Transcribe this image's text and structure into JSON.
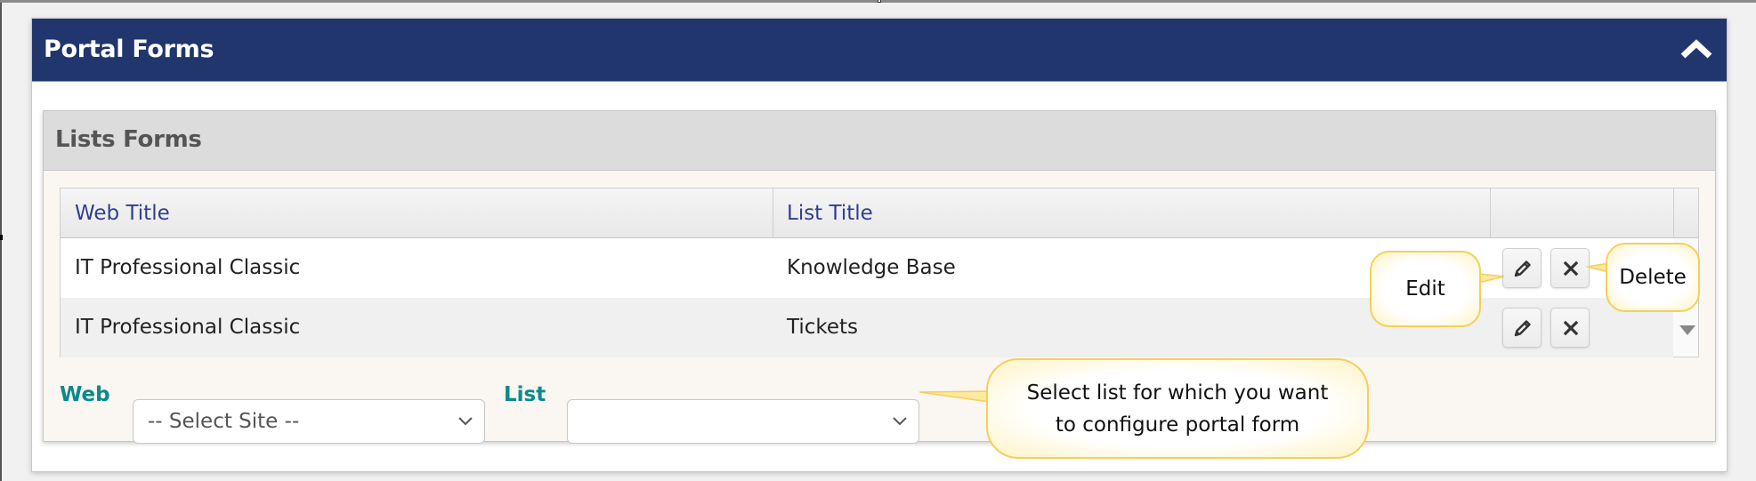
{
  "panel": {
    "title": "Portal Forms",
    "collapse_icon": "chevron-up-icon"
  },
  "lists_forms": {
    "title": "Lists Forms",
    "table": {
      "columns": [
        "Web Title",
        "List Title",
        ""
      ],
      "rows": [
        {
          "web_title": "IT Professional Classic",
          "list_title": "Knowledge Base",
          "actions": [
            "edit",
            "delete"
          ]
        },
        {
          "web_title": "IT Professional Classic",
          "list_title": "Tickets",
          "actions": [
            "edit",
            "delete"
          ]
        }
      ],
      "scroll_icon": "triangle-down-icon"
    },
    "filters": {
      "web_label": "Web",
      "web_select_value": "-- Select Site --",
      "list_label": "List",
      "list_select_value": ""
    }
  },
  "callouts": {
    "edit": "Edit",
    "delete": "Delete",
    "select_list_line1": "Select list for which you want",
    "select_list_line2": "to configure portal form"
  },
  "colors": {
    "header_bg": "#20366d",
    "label_teal": "#0b8a8a",
    "column_header_text": "#2f3f8f",
    "callout_border": "#f6cf57"
  }
}
